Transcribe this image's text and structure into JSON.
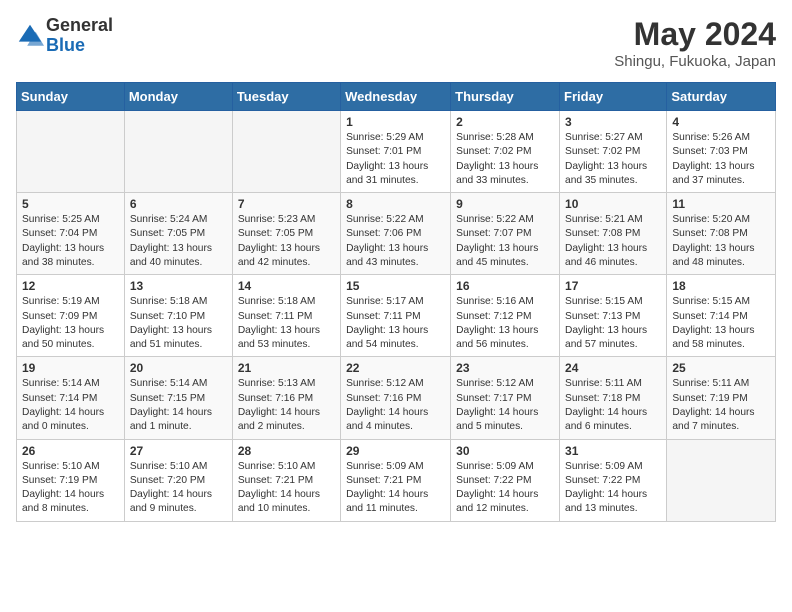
{
  "logo": {
    "general": "General",
    "blue": "Blue"
  },
  "title": "May 2024",
  "subtitle": "Shingu, Fukuoka, Japan",
  "days_header": [
    "Sunday",
    "Monday",
    "Tuesday",
    "Wednesday",
    "Thursday",
    "Friday",
    "Saturday"
  ],
  "weeks": [
    [
      {
        "num": "",
        "info": ""
      },
      {
        "num": "",
        "info": ""
      },
      {
        "num": "",
        "info": ""
      },
      {
        "num": "1",
        "info": "Sunrise: 5:29 AM\nSunset: 7:01 PM\nDaylight: 13 hours and 31 minutes."
      },
      {
        "num": "2",
        "info": "Sunrise: 5:28 AM\nSunset: 7:02 PM\nDaylight: 13 hours and 33 minutes."
      },
      {
        "num": "3",
        "info": "Sunrise: 5:27 AM\nSunset: 7:02 PM\nDaylight: 13 hours and 35 minutes."
      },
      {
        "num": "4",
        "info": "Sunrise: 5:26 AM\nSunset: 7:03 PM\nDaylight: 13 hours and 37 minutes."
      }
    ],
    [
      {
        "num": "5",
        "info": "Sunrise: 5:25 AM\nSunset: 7:04 PM\nDaylight: 13 hours and 38 minutes."
      },
      {
        "num": "6",
        "info": "Sunrise: 5:24 AM\nSunset: 7:05 PM\nDaylight: 13 hours and 40 minutes."
      },
      {
        "num": "7",
        "info": "Sunrise: 5:23 AM\nSunset: 7:05 PM\nDaylight: 13 hours and 42 minutes."
      },
      {
        "num": "8",
        "info": "Sunrise: 5:22 AM\nSunset: 7:06 PM\nDaylight: 13 hours and 43 minutes."
      },
      {
        "num": "9",
        "info": "Sunrise: 5:22 AM\nSunset: 7:07 PM\nDaylight: 13 hours and 45 minutes."
      },
      {
        "num": "10",
        "info": "Sunrise: 5:21 AM\nSunset: 7:08 PM\nDaylight: 13 hours and 46 minutes."
      },
      {
        "num": "11",
        "info": "Sunrise: 5:20 AM\nSunset: 7:08 PM\nDaylight: 13 hours and 48 minutes."
      }
    ],
    [
      {
        "num": "12",
        "info": "Sunrise: 5:19 AM\nSunset: 7:09 PM\nDaylight: 13 hours and 50 minutes."
      },
      {
        "num": "13",
        "info": "Sunrise: 5:18 AM\nSunset: 7:10 PM\nDaylight: 13 hours and 51 minutes."
      },
      {
        "num": "14",
        "info": "Sunrise: 5:18 AM\nSunset: 7:11 PM\nDaylight: 13 hours and 53 minutes."
      },
      {
        "num": "15",
        "info": "Sunrise: 5:17 AM\nSunset: 7:11 PM\nDaylight: 13 hours and 54 minutes."
      },
      {
        "num": "16",
        "info": "Sunrise: 5:16 AM\nSunset: 7:12 PM\nDaylight: 13 hours and 56 minutes."
      },
      {
        "num": "17",
        "info": "Sunrise: 5:15 AM\nSunset: 7:13 PM\nDaylight: 13 hours and 57 minutes."
      },
      {
        "num": "18",
        "info": "Sunrise: 5:15 AM\nSunset: 7:14 PM\nDaylight: 13 hours and 58 minutes."
      }
    ],
    [
      {
        "num": "19",
        "info": "Sunrise: 5:14 AM\nSunset: 7:14 PM\nDaylight: 14 hours and 0 minutes."
      },
      {
        "num": "20",
        "info": "Sunrise: 5:14 AM\nSunset: 7:15 PM\nDaylight: 14 hours and 1 minute."
      },
      {
        "num": "21",
        "info": "Sunrise: 5:13 AM\nSunset: 7:16 PM\nDaylight: 14 hours and 2 minutes."
      },
      {
        "num": "22",
        "info": "Sunrise: 5:12 AM\nSunset: 7:16 PM\nDaylight: 14 hours and 4 minutes."
      },
      {
        "num": "23",
        "info": "Sunrise: 5:12 AM\nSunset: 7:17 PM\nDaylight: 14 hours and 5 minutes."
      },
      {
        "num": "24",
        "info": "Sunrise: 5:11 AM\nSunset: 7:18 PM\nDaylight: 14 hours and 6 minutes."
      },
      {
        "num": "25",
        "info": "Sunrise: 5:11 AM\nSunset: 7:19 PM\nDaylight: 14 hours and 7 minutes."
      }
    ],
    [
      {
        "num": "26",
        "info": "Sunrise: 5:10 AM\nSunset: 7:19 PM\nDaylight: 14 hours and 8 minutes."
      },
      {
        "num": "27",
        "info": "Sunrise: 5:10 AM\nSunset: 7:20 PM\nDaylight: 14 hours and 9 minutes."
      },
      {
        "num": "28",
        "info": "Sunrise: 5:10 AM\nSunset: 7:21 PM\nDaylight: 14 hours and 10 minutes."
      },
      {
        "num": "29",
        "info": "Sunrise: 5:09 AM\nSunset: 7:21 PM\nDaylight: 14 hours and 11 minutes."
      },
      {
        "num": "30",
        "info": "Sunrise: 5:09 AM\nSunset: 7:22 PM\nDaylight: 14 hours and 12 minutes."
      },
      {
        "num": "31",
        "info": "Sunrise: 5:09 AM\nSunset: 7:22 PM\nDaylight: 14 hours and 13 minutes."
      },
      {
        "num": "",
        "info": ""
      }
    ]
  ]
}
